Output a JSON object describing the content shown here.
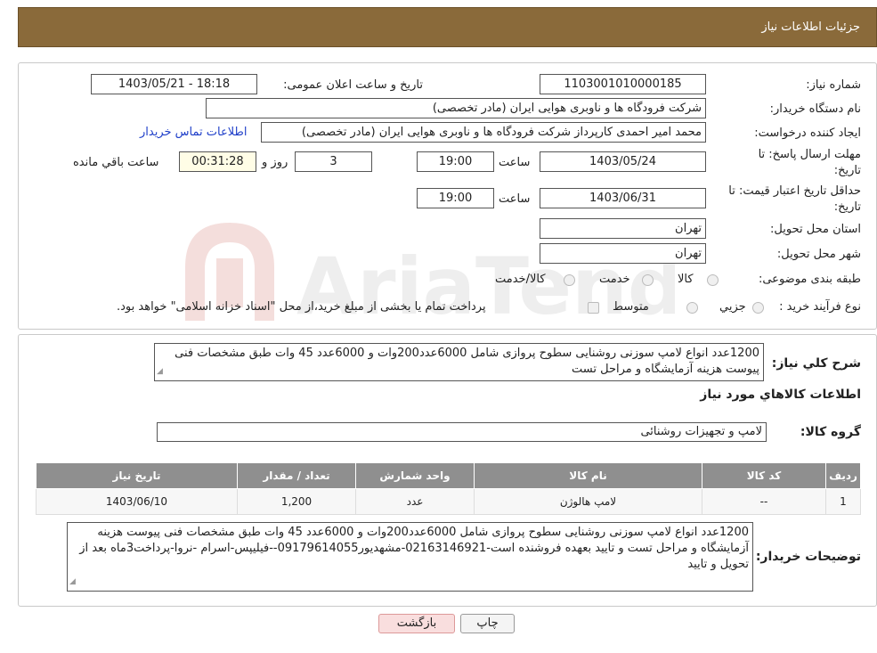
{
  "header": {
    "title": "جزئیات اطلاعات نیاز"
  },
  "form": {
    "need_number_label": "شماره نیاز:",
    "need_number": "1103001010000185",
    "announce_label": "تاریخ و ساعت اعلان عمومی:",
    "announce_value": "1403/05/21 - 18:18",
    "buyer_label": "نام دستگاه خریدار:",
    "buyer_value": "شرکت فرودگاه ها و ناوبری هوایی ایران (مادر تخصصی)",
    "creator_label": "ایجاد کننده درخواست:",
    "creator_value": "محمد امیر احمدی کارپرداز شرکت فرودگاه ها و ناوبری هوایی ایران (مادر تخصصی)",
    "contact_link": "اطلاعات تماس خریدار",
    "deadline_label_1": "مهلت ارسال پاسخ: تا",
    "deadline_label_2": "تاریخ:",
    "deadline_date": "1403/05/24",
    "time_label": "ساعت",
    "deadline_time": "19:00",
    "days_value": "3",
    "days_label": "روز و",
    "remaining_time": "00:31:28",
    "remaining_label": "ساعت باقي مانده",
    "validity_label_1": "حداقل تاریخ اعتبار قیمت: تا",
    "validity_label_2": "تاریخ:",
    "validity_date": "1403/06/31",
    "validity_time": "19:00",
    "province_label": "استان محل تحویل:",
    "province_value": "تهران",
    "city_label": "شهر محل تحویل:",
    "city_value": "تهران",
    "category_label": "طبقه بندی موضوعی:",
    "category_options": [
      "کالا",
      "خدمت",
      "کالا/خدمت"
    ],
    "process_label": "نوع فرآیند خرید :",
    "process_options": [
      "جزیي",
      "متوسط"
    ],
    "payment_note": "پرداخت تمام یا بخشی از مبلغ خرید،از محل \"اسناد خزانه اسلامی\" خواهد بود."
  },
  "details": {
    "summary_label": "شرح کلي نیاز:",
    "summary_text": "1200عدد انواع لامپ سوزنی روشنایی سطوح پروازی شامل 6000عدد200وات و 6000عدد 45 وات طبق مشخصات فنی پیوست هزینه آزمایشگاه و مراحل تست",
    "goods_info_title": "اطلاعات کالاهاي مورد نیاز",
    "goods_group_label": "گروه کالا:",
    "goods_group_value": "لامپ و تجهیزات روشنائی",
    "table": {
      "headers": [
        "ردیف",
        "کد کالا",
        "نام کالا",
        "واحد شمارش",
        "تعداد / مقدار",
        "تاریخ نیاز"
      ],
      "rows": [
        [
          "1",
          "--",
          "لامپ هالوژن",
          "عدد",
          "1,200",
          "1403/06/10"
        ]
      ]
    },
    "buyer_notes_label": "توضیحات خریدار:",
    "buyer_notes_text": "1200عدد انواع لامپ سوزنی روشنایی سطوح پروازی شامل 6000عدد200وات و 6000عدد 45 وات طبق مشخصات فنی پیوست هزینه آزمایشگاه و مراحل تست و تایید بعهده فروشنده است-02163146921-مشهدیور09179614055--فیلیپس-اسرام -نروا-پرداخت3ماه بعد از تحویل و تایید"
  },
  "buttons": {
    "print": "چاپ",
    "back": "بازگشت"
  },
  "watermark": {
    "text": "AriaTender.neT"
  }
}
